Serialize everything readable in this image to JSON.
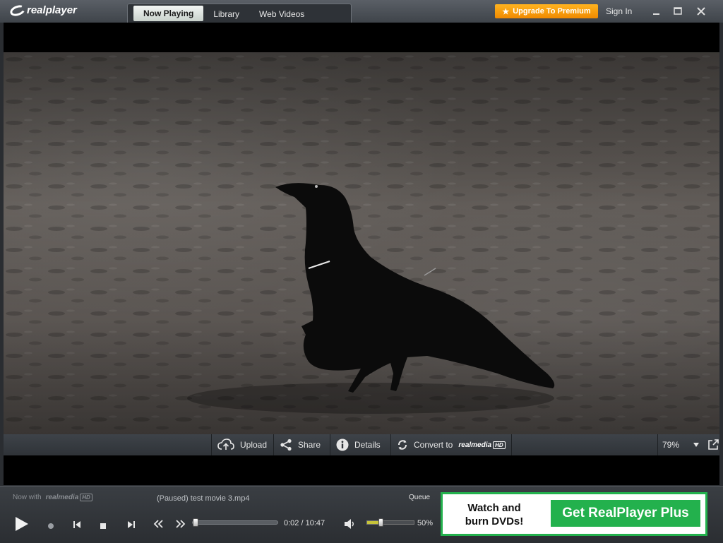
{
  "app": {
    "logo_text": "realplayer"
  },
  "tabs": [
    {
      "label": "Now Playing",
      "active": true
    },
    {
      "label": "Library",
      "active": false
    },
    {
      "label": "Web Videos",
      "active": false
    }
  ],
  "header": {
    "upgrade_label": "Upgrade To Premium",
    "signin_label": "Sign In",
    "upgrade_color": "#f5a000"
  },
  "video_toolbar": {
    "upload_label": "Upload",
    "share_label": "Share",
    "details_label": "Details",
    "convert_label": "Convert to",
    "convert_brand": "realmedia",
    "convert_hd": "HD",
    "zoom_value": "79%"
  },
  "footer": {
    "now_with": "Now with",
    "now_with_brand": "realmedia",
    "now_with_hd": "HD",
    "status": "(Paused) test movie 3.mp4",
    "queue_label": "Queue",
    "time": "0:02 / 10:47",
    "seek_fraction": 0.003,
    "volume_percent": "50%",
    "volume_fraction": 0.28
  },
  "promo": {
    "line1": "Watch and",
    "line2": "burn DVDs!",
    "button_label": "Get RealPlayer Plus",
    "accent": "#23b14d"
  },
  "icons": [
    "star-icon",
    "minimize-icon",
    "maximize-icon",
    "close-icon",
    "upload-icon",
    "share-icon",
    "info-icon",
    "convert-icon",
    "popout-icon",
    "play-icon",
    "record-icon",
    "previous-icon",
    "stop-icon",
    "next-icon",
    "rewind-icon",
    "fast-forward-icon",
    "volume-icon"
  ]
}
